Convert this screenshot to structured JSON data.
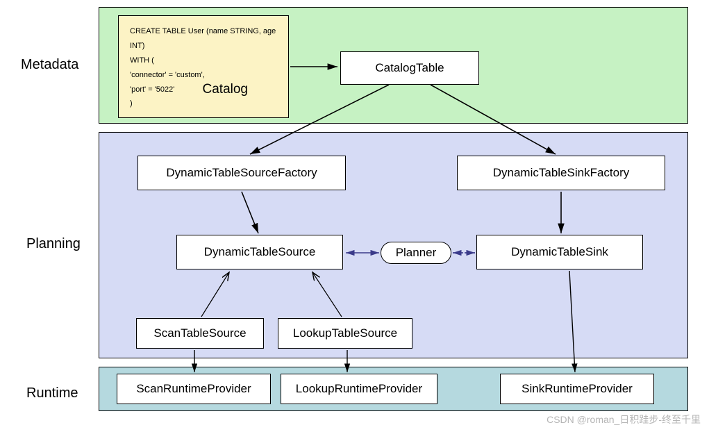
{
  "labels": {
    "metadata": "Metadata",
    "planning": "Planning",
    "runtime": "Runtime"
  },
  "catalog": {
    "line1": "CREATE TABLE User (name STRING, age INT)",
    "line2": "WITH (",
    "line3": "    'connector' = 'custom',",
    "line4": "    'port' = '5022'",
    "line5": ")",
    "title": "Catalog"
  },
  "boxes": {
    "catalogTable": "CatalogTable",
    "sourceFactory": "DynamicTableSourceFactory",
    "sinkFactory": "DynamicTableSinkFactory",
    "tableSource": "DynamicTableSource",
    "tableSink": "DynamicTableSink",
    "planner": "Planner",
    "scanTableSource": "ScanTableSource",
    "lookupTableSource": "LookupTableSource",
    "scanRuntime": "ScanRuntimeProvider",
    "lookupRuntime": "LookupRuntimeProvider",
    "sinkRuntime": "SinkRuntimeProvider"
  },
  "watermark": "CSDN @roman_日积跬步-终至千里"
}
